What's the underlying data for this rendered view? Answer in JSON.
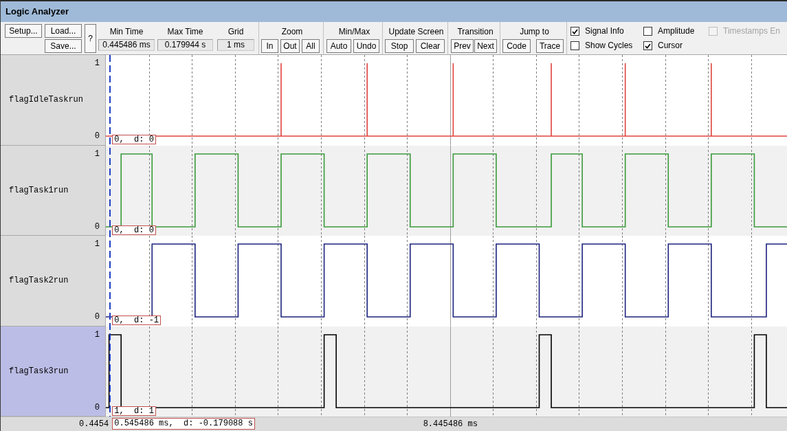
{
  "window": {
    "title": "Logic Analyzer"
  },
  "toolbar": {
    "setup_button": "Setup...",
    "load_button": "Load...",
    "save_button": "Save...",
    "help_button": "?",
    "fields": [
      {
        "label": "Min Time",
        "value": "0.445486 ms"
      },
      {
        "label": "Max Time",
        "value": "0.179944 s"
      },
      {
        "label": "Grid",
        "value": "1 ms"
      }
    ],
    "button_groups": [
      {
        "label": "Zoom",
        "buttons": [
          "In",
          "Out",
          "All"
        ]
      },
      {
        "label": "Min/Max",
        "buttons": [
          "Auto",
          "Undo"
        ]
      },
      {
        "label": "Update Screen",
        "buttons": [
          "Stop",
          "Clear"
        ]
      },
      {
        "label": "Transition",
        "buttons": [
          "Prev",
          "Next"
        ]
      },
      {
        "label": "Jump to",
        "buttons": [
          "Code",
          "Trace"
        ]
      }
    ],
    "options": [
      {
        "label": "Signal Info",
        "checked": true,
        "disabled": false
      },
      {
        "label": "Amplitude",
        "checked": false,
        "disabled": false
      },
      {
        "label": "Timestamps En",
        "checked": false,
        "disabled": true
      },
      {
        "label": "Show Cycles",
        "checked": false,
        "disabled": false
      },
      {
        "label": "Cursor",
        "checked": true,
        "disabled": false
      }
    ]
  },
  "signals": [
    {
      "name": "flagIdleTaskrun",
      "selected": false,
      "color": "#e0433f",
      "high_label": "1",
      "low_label": "0",
      "readout": "0,  d: 0"
    },
    {
      "name": "flagTask1run",
      "selected": false,
      "color": "#3a9a3a",
      "high_label": "1",
      "low_label": "0",
      "readout": "0,  d: 0"
    },
    {
      "name": "flagTask2run",
      "selected": false,
      "color": "#1c237e",
      "high_label": "1",
      "low_label": "0",
      "readout": "0,  d: -1"
    },
    {
      "name": "flagTask3run",
      "selected": true,
      "color": "#000000",
      "high_label": "1",
      "low_label": "0",
      "readout": "1,  d: 1"
    }
  ],
  "time_axis": {
    "labels": [
      "0.4454",
      "8.445486 ms"
    ],
    "cursor_readout": "0.545486 ms,  d: -0.179088 s"
  }
}
